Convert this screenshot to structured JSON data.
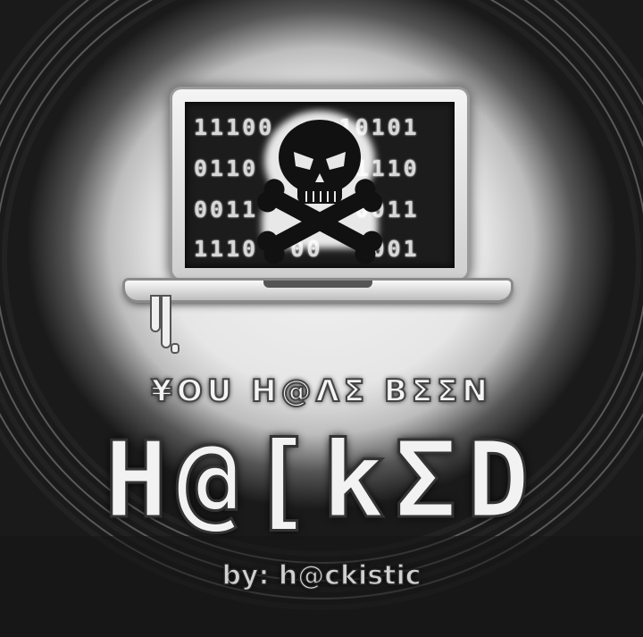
{
  "screen": {
    "binary_lines": [
      "11100    10101",
      "0110      1110",
      "0011      0011",
      "1110  00  1001"
    ]
  },
  "tagline": "¥OU H@ΛΣ BΣΣN",
  "title": "H@[kΣD",
  "byline": "by: h@ckistic",
  "icons": [
    "skull-crossbones-icon",
    "laptop-icon"
  ],
  "colors": {
    "background_dark": "#111111",
    "glow": "#eeeeee",
    "screen": "#1c1c1c"
  }
}
